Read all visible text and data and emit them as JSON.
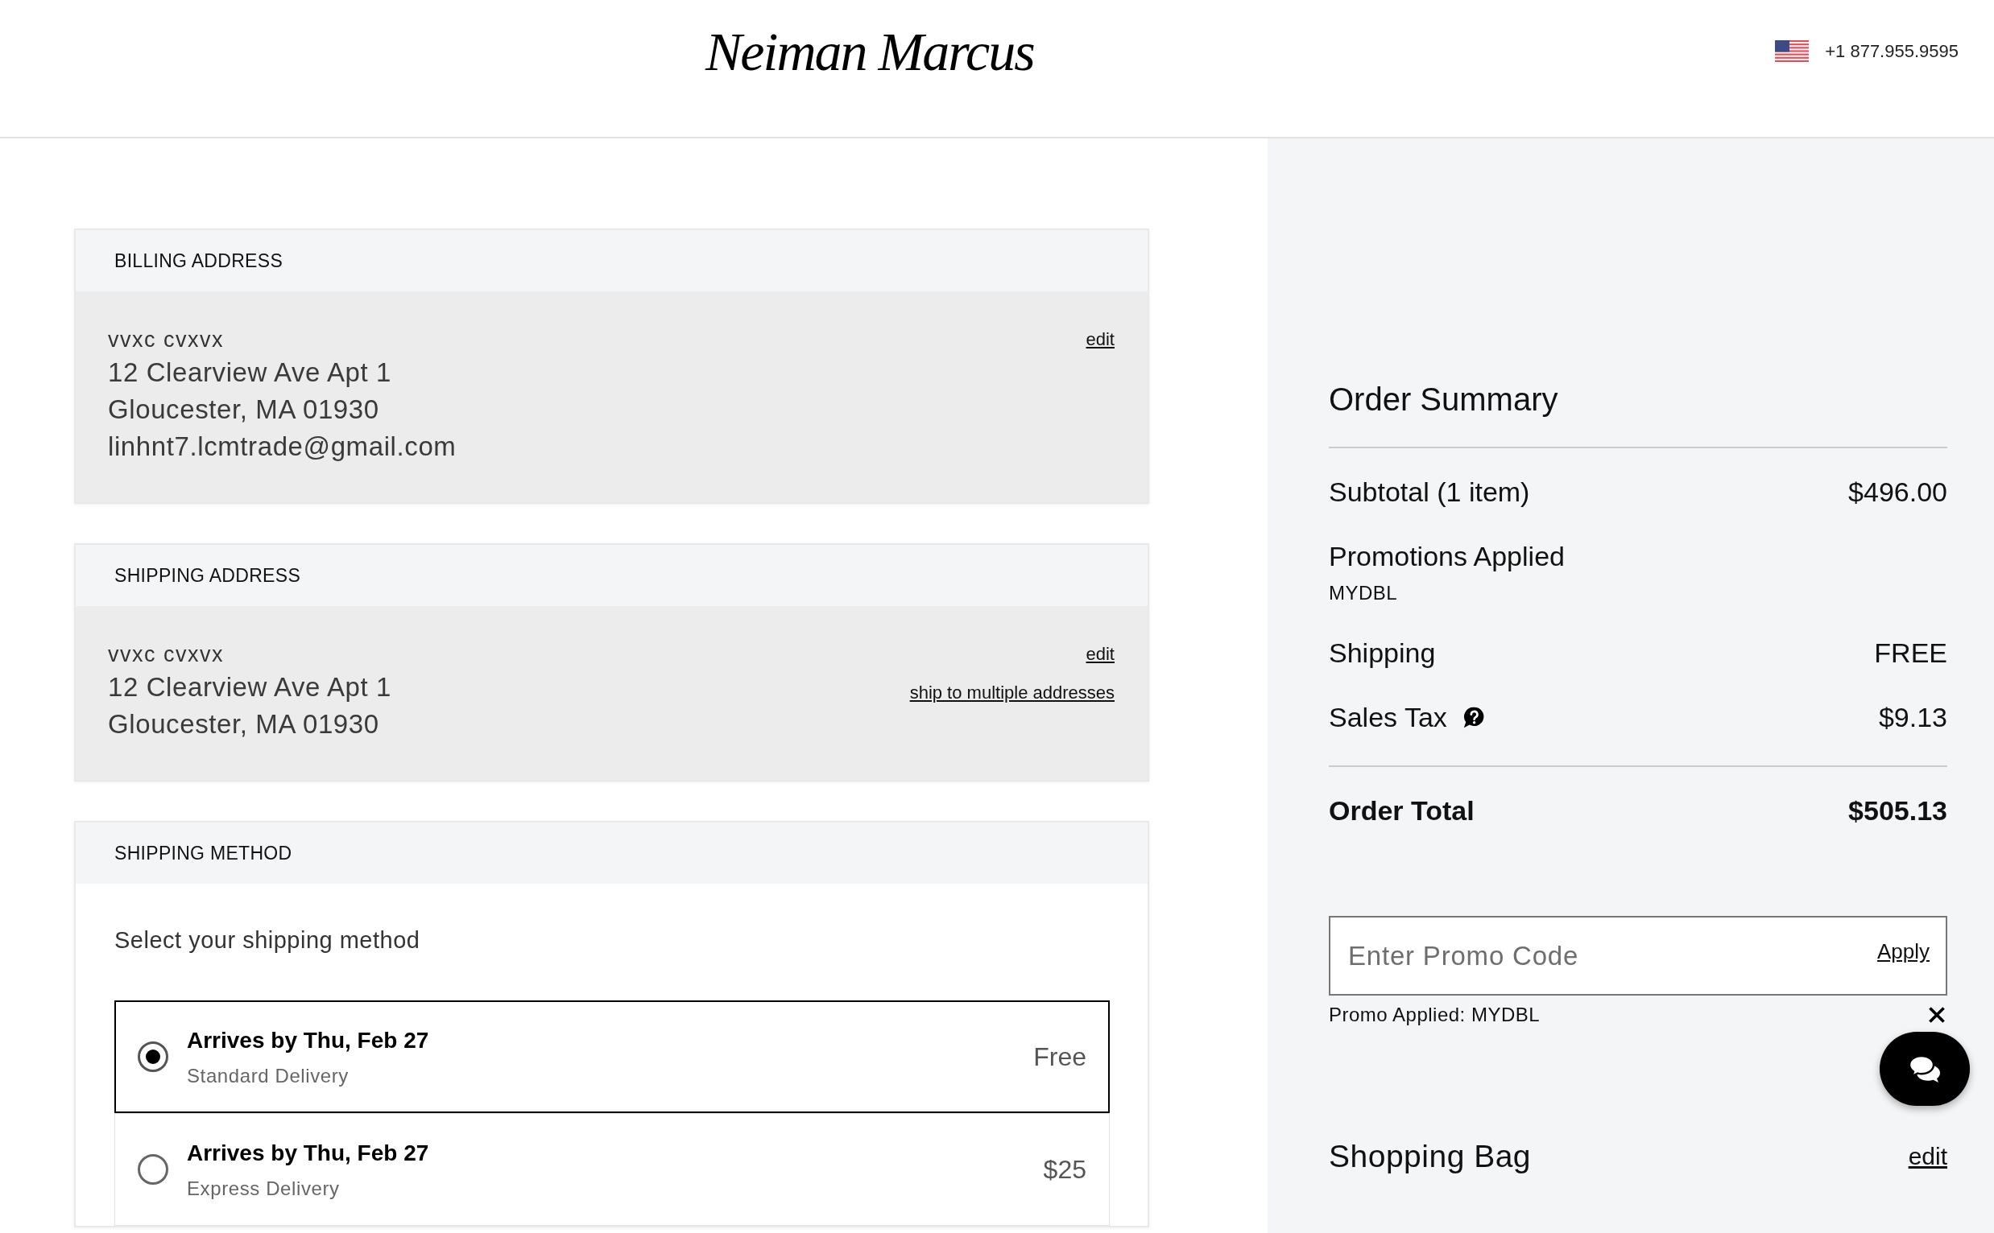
{
  "header": {
    "logo": "Neiman Marcus",
    "phone": "+1 877.955.9595"
  },
  "billing_address": {
    "heading": "BILLING ADDRESS",
    "name": "vvxc cvxvx",
    "lines": [
      "12 Clearview Ave Apt 1",
      "Gloucester, MA 01930",
      "linhnt7.lcmtrade@gmail.com"
    ],
    "links": [
      "edit"
    ]
  },
  "shipping_address": {
    "heading": "SHIPPING ADDRESS",
    "name": "vvxc cvxvx",
    "lines": [
      "12 Clearview Ave Apt 1",
      "Gloucester, MA 01930"
    ],
    "links": [
      "edit",
      "ship to multiple addresses"
    ]
  },
  "shipping_method": {
    "heading": "SHIPPING METHOD",
    "prompt": "Select your shipping method",
    "options": [
      {
        "title": "Arrives by Thu, Feb 27",
        "service": "Standard Delivery",
        "price": "Free",
        "selected": true
      },
      {
        "title": "Arrives by Thu, Feb 27",
        "service": "Express Delivery",
        "price": "$25",
        "selected": false
      }
    ]
  },
  "order_summary": {
    "title": "Order Summary",
    "lines": [
      {
        "kind": "amount",
        "label": "Subtotal (1 item)",
        "value": "$496.00"
      },
      {
        "kind": "promo",
        "label": "Promotions Applied",
        "code": "MYDBL"
      },
      {
        "kind": "amount",
        "label": "Shipping",
        "value": "FREE"
      },
      {
        "kind": "tax",
        "label": "Sales Tax",
        "value": "$9.13"
      }
    ],
    "total": {
      "label": "Order Total",
      "value": "$505.13"
    },
    "promo": {
      "placeholder": "Enter Promo Code",
      "action": "Apply",
      "applied": "Promo Applied: MYDBL"
    }
  },
  "shopping_bag": {
    "title": "Shopping Bag",
    "action": "edit"
  }
}
